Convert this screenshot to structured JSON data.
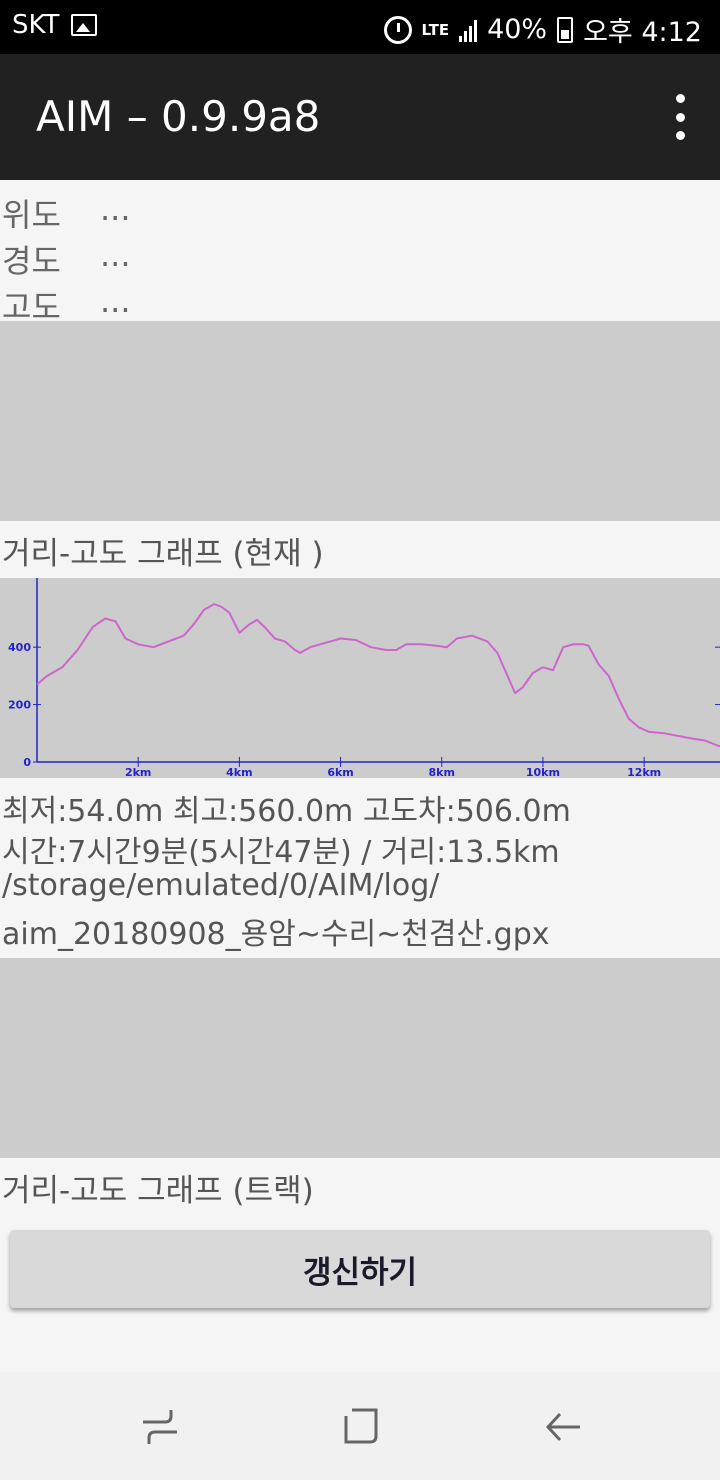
{
  "status_bar": {
    "carrier": "SKT",
    "network": "LTE",
    "battery": "40%",
    "time": "오후 4:12",
    "icons": [
      "image-icon",
      "alarm-icon",
      "signal-icon",
      "battery-icon"
    ]
  },
  "action_bar": {
    "title": "AIM – 0.9.9a8",
    "menu_icon": "more-vert-icon"
  },
  "coordinates": {
    "latitude": {
      "label": "위도",
      "value": "..."
    },
    "longitude": {
      "label": "경도",
      "value": "..."
    },
    "altitude": {
      "label": "고도",
      "value": "..."
    }
  },
  "current_graph": {
    "title": "거리-고도 그래프 (현재 )"
  },
  "track_info": {
    "stats": "최저:54.0m 최고:560.0m 고도차:506.0m",
    "time_distance": "시간:7시간9분(5시간47분) / 거리:13.5km",
    "path_line1": "/storage/emulated/0/AIM/log/",
    "path_line2": "aim_20180908_용암~수리~천겸산.gpx"
  },
  "track_graph": {
    "title": "거리-고도 그래프 (트랙)"
  },
  "refresh_button": {
    "label": "갱신하기"
  },
  "nav_bar": {
    "icons": [
      "recent-apps-icon",
      "home-icon",
      "back-icon"
    ]
  },
  "colors": {
    "status_bar": "#000000",
    "action_bar": "#212121",
    "chart_bg": "#cccccc",
    "axis": "#2323cc",
    "series": "#cc66cc"
  },
  "chart_data": {
    "type": "line",
    "x_unit": "km",
    "y_unit": "m",
    "xlim": [
      0,
      13.5
    ],
    "ylim": [
      0,
      620
    ],
    "x_ticks": [
      {
        "value": 2,
        "label": "2km"
      },
      {
        "value": 4,
        "label": "4km"
      },
      {
        "value": 6,
        "label": "6km"
      },
      {
        "value": 8,
        "label": "8km"
      },
      {
        "value": 10,
        "label": "10km"
      },
      {
        "value": 12,
        "label": "12km"
      }
    ],
    "y_ticks": [
      {
        "value": 0,
        "label": "0"
      },
      {
        "value": 200,
        "label": "200"
      },
      {
        "value": 400,
        "label": "400"
      }
    ],
    "series": [
      {
        "x": [
          0,
          0.2,
          0.5,
          0.8,
          1.1,
          1.35,
          1.55,
          1.75,
          2.0,
          2.3,
          2.6,
          2.9,
          3.1,
          3.3,
          3.5,
          3.65,
          3.8,
          4.0,
          4.2,
          4.35,
          4.5,
          4.7,
          4.9,
          5.1,
          5.2,
          5.4,
          5.6,
          5.8,
          6.0,
          6.3,
          6.6,
          6.9,
          7.1,
          7.3,
          7.6,
          7.9,
          8.1,
          8.3,
          8.6,
          8.9,
          9.1,
          9.3,
          9.45,
          9.6,
          9.8,
          10.0,
          10.2,
          10.4,
          10.6,
          10.8,
          10.9,
          11.1,
          11.3,
          11.5,
          11.7,
          11.9,
          12.1,
          12.4,
          12.7,
          13.0,
          13.2,
          13.5
        ],
        "y": [
          270,
          300,
          330,
          390,
          470,
          500,
          490,
          430,
          410,
          400,
          420,
          440,
          480,
          530,
          550,
          540,
          520,
          450,
          480,
          495,
          470,
          430,
          420,
          390,
          380,
          400,
          410,
          420,
          430,
          425,
          400,
          390,
          390,
          410,
          410,
          405,
          400,
          430,
          440,
          420,
          380,
          300,
          240,
          260,
          310,
          330,
          320,
          400,
          410,
          410,
          405,
          340,
          300,
          220,
          150,
          120,
          105,
          100,
          90,
          80,
          75,
          54
        ]
      }
    ]
  }
}
